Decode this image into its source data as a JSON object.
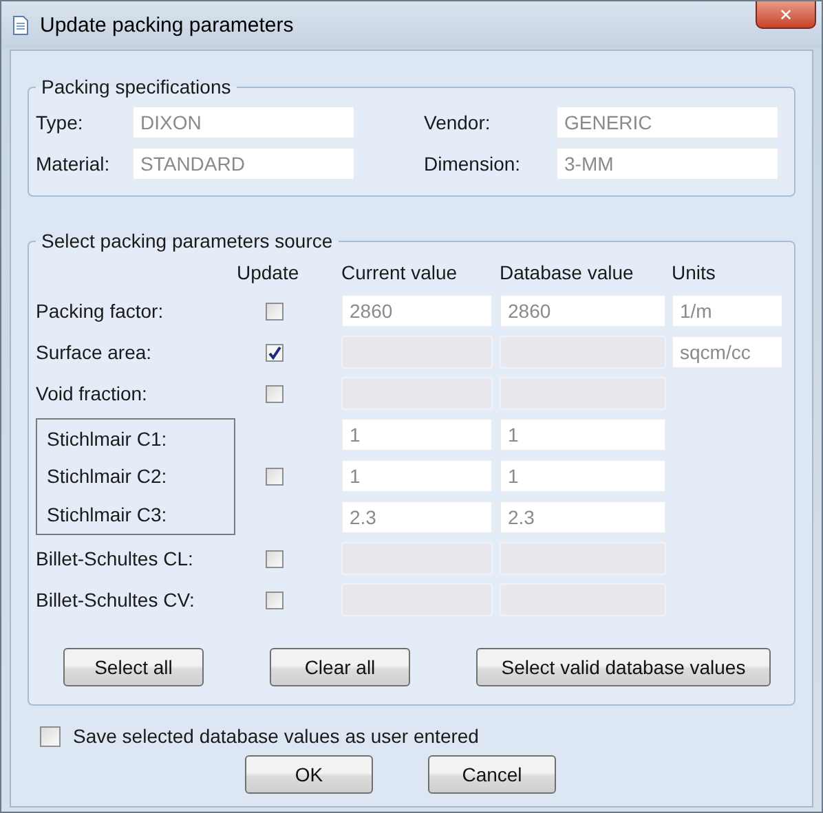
{
  "window": {
    "title": "Update packing parameters",
    "close": "✕"
  },
  "specifications": {
    "legend": "Packing specifications",
    "fields": [
      {
        "label": "Type:",
        "value": "DIXON"
      },
      {
        "label": "Vendor:",
        "value": "GENERIC"
      },
      {
        "label": "Material:",
        "value": "STANDARD"
      },
      {
        "label": "Dimension:",
        "value": "3-MM"
      }
    ]
  },
  "source": {
    "legend": "Select packing parameters source",
    "columns": [
      "Update",
      "Current value",
      "Database value",
      "Units"
    ],
    "parameters": [
      {
        "kind": "single",
        "label": "Packing factor:",
        "checked": false,
        "current": {
          "value": "2860",
          "enabled": true
        },
        "database": {
          "value": "2860",
          "enabled": true
        },
        "units": "1/m"
      },
      {
        "kind": "single",
        "label": "Surface area:",
        "checked": true,
        "current": {
          "enabled": false
        },
        "database": {
          "enabled": false
        },
        "units": "sqcm/cc"
      },
      {
        "kind": "single",
        "label": "Void fraction:",
        "checked": false,
        "current": {
          "enabled": false
        },
        "database": {
          "enabled": false
        }
      },
      {
        "kind": "group",
        "checked": false,
        "rows": [
          {
            "label": "Stichlmair C1:",
            "current": {
              "value": "1",
              "enabled": true
            },
            "database": {
              "value": "1",
              "enabled": true
            }
          },
          {
            "label": "Stichlmair C2:",
            "current": {
              "value": "1",
              "enabled": true
            },
            "database": {
              "value": "1",
              "enabled": true
            }
          },
          {
            "label": "Stichlmair C3:",
            "current": {
              "value": "2.3",
              "enabled": true
            },
            "database": {
              "value": "2.3",
              "enabled": true
            }
          }
        ]
      },
      {
        "kind": "single",
        "label": "Billet-Schultes CL:",
        "checked": false,
        "current": {
          "enabled": false
        },
        "database": {
          "enabled": false
        }
      },
      {
        "kind": "single",
        "label": "Billet-Schultes CV:",
        "checked": false,
        "current": {
          "enabled": false
        },
        "database": {
          "enabled": false
        }
      }
    ],
    "buttons": [
      "Select all",
      "Clear all",
      "Select valid database values"
    ]
  },
  "save_option": {
    "label": "Save selected database values as user entered",
    "checked": false
  },
  "buttons": [
    "OK",
    "Cancel"
  ]
}
